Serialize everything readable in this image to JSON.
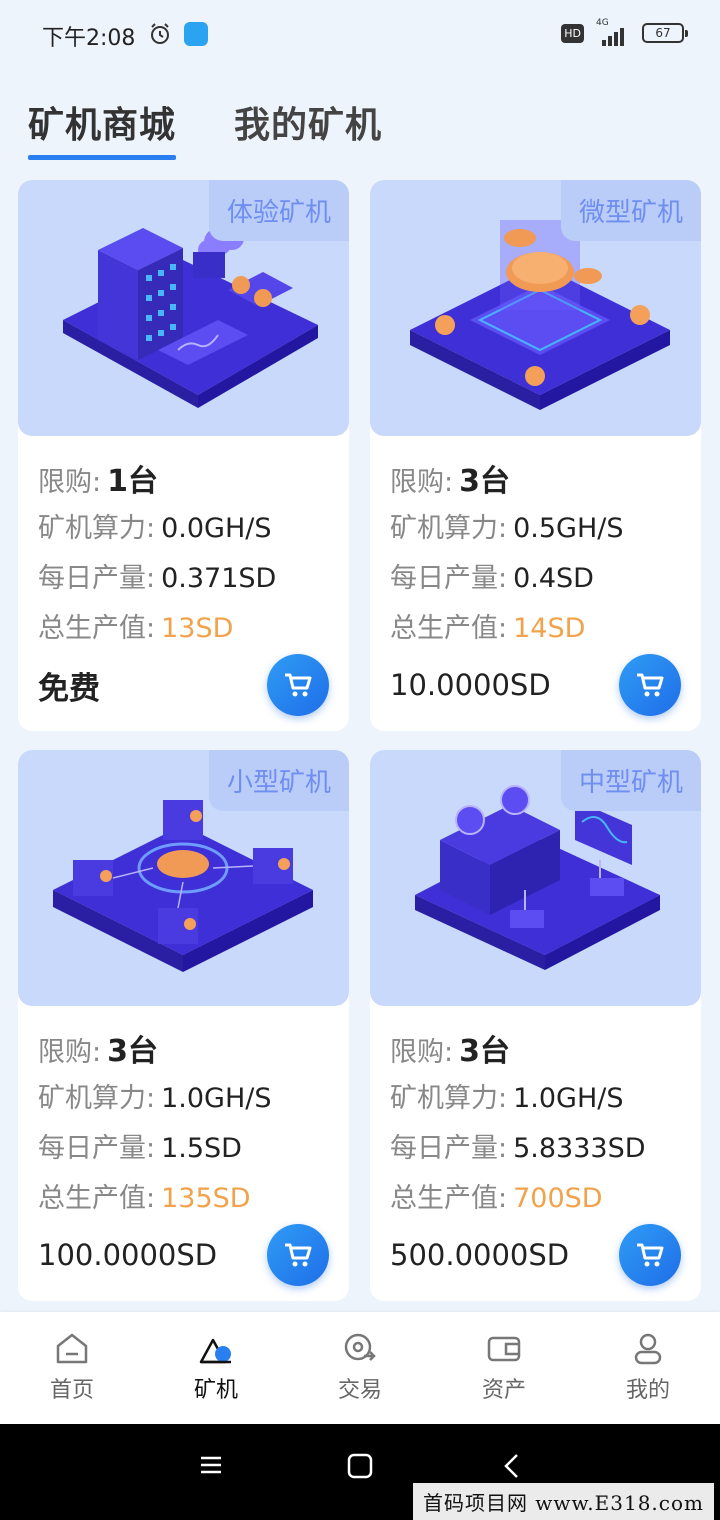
{
  "status_bar": {
    "time": "下午2:08",
    "hd": "HD",
    "network": "4G",
    "battery": "67"
  },
  "tabs": [
    {
      "label": "矿机商城",
      "active": true
    },
    {
      "label": "我的矿机",
      "active": false
    }
  ],
  "labels": {
    "limit": "限购:",
    "hashrate": "矿机算力:",
    "daily": "每日产量:",
    "total": "总生产值:"
  },
  "cards": [
    {
      "tag": "体验矿机",
      "limit": "1台",
      "hashrate": "0.0GH/S",
      "daily": "0.371SD",
      "total": "13SD",
      "price": "免费"
    },
    {
      "tag": "微型矿机",
      "limit": "3台",
      "hashrate": "0.5GH/S",
      "daily": "0.4SD",
      "total": "14SD",
      "price": "10.0000SD"
    },
    {
      "tag": "小型矿机",
      "limit": "3台",
      "hashrate": "1.0GH/S",
      "daily": "1.5SD",
      "total": "135SD",
      "price": "100.0000SD"
    },
    {
      "tag": "中型矿机",
      "limit": "3台",
      "hashrate": "1.0GH/S",
      "daily": "5.8333SD",
      "total": "700SD",
      "price": "500.0000SD"
    }
  ],
  "bottom_nav": [
    {
      "label": "首页",
      "icon": "home-icon",
      "active": false
    },
    {
      "label": "矿机",
      "icon": "miner-icon",
      "active": true
    },
    {
      "label": "交易",
      "icon": "trade-icon",
      "active": false
    },
    {
      "label": "资产",
      "icon": "wallet-icon",
      "active": false
    },
    {
      "label": "我的",
      "icon": "user-icon",
      "active": false
    }
  ],
  "watermark": "首码项目网 www.E318.com",
  "colors": {
    "accent": "#2a7ff0",
    "orange": "#f2a24a",
    "card_bg": "#c8d9fb",
    "tag_text": "#6f8ef0"
  }
}
